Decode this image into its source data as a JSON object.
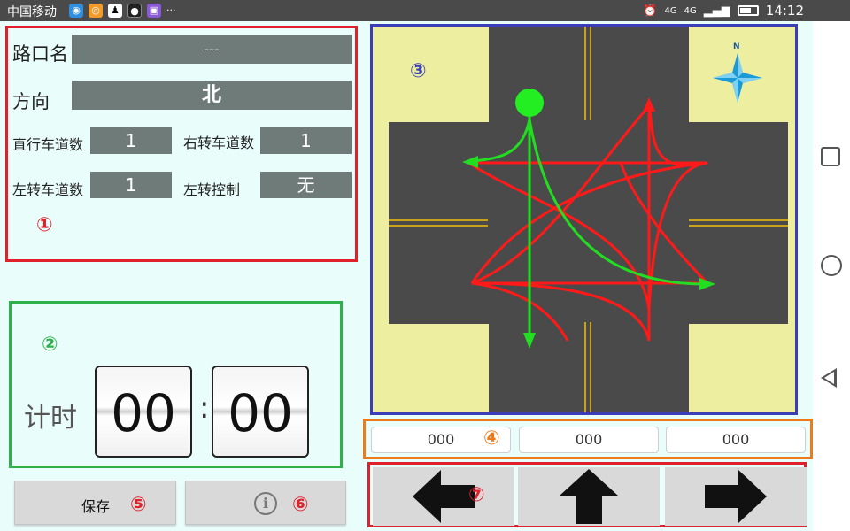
{
  "status_bar": {
    "carrier": "中国移动",
    "more": "···",
    "network1": "4G",
    "network2": "4G",
    "time": "14:12"
  },
  "panel1": {
    "marker": "①",
    "name_label": "路口名",
    "name_value": "---",
    "direction_label": "方向",
    "direction_value": "北",
    "straight_lanes_label": "直行车道数",
    "straight_lanes_value": "1",
    "right_lanes_label": "右转车道数",
    "right_lanes_value": "1",
    "left_lanes_label": "左转车道数",
    "left_lanes_value": "1",
    "left_control_label": "左转控制",
    "left_control_value": "无"
  },
  "panel2": {
    "marker": "②",
    "timer_label": "计时",
    "minutes": "00",
    "colon": ":",
    "seconds": "00"
  },
  "panel3": {
    "marker": "③",
    "compass_letter": "N"
  },
  "panel4": {
    "marker": "④",
    "values": [
      "000",
      "000",
      "000"
    ]
  },
  "buttons": {
    "save_label": "保存",
    "save_marker": "⑤",
    "info_marker": "⑥"
  },
  "panel7": {
    "marker": "⑦"
  },
  "colors": {
    "red_frame": "#e0202a",
    "green_frame": "#2eb14a",
    "blue_frame": "#3a3fb7",
    "orange_frame": "#f07a1a",
    "field_bg": "#6f7b79",
    "road": "#4a4a4a",
    "grass": "#eeeea0",
    "active_path": "#22dd22",
    "other_path": "#ff1a1a"
  }
}
